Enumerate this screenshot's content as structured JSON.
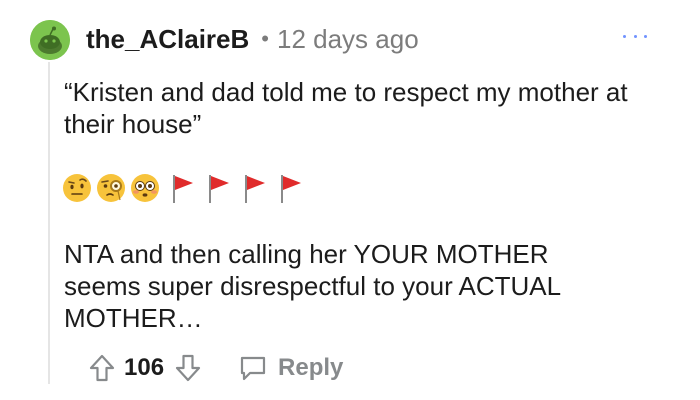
{
  "comment": {
    "author": "the_AClaireB",
    "separator": "•",
    "age": "12 days ago",
    "quote": "“Kristen and dad told me to respect my mother at their house”",
    "emojis": [
      "face-with-raised-eyebrow",
      "face-with-monocle",
      "flushed-face",
      "red-flag",
      "red-flag",
      "red-flag",
      "red-flag"
    ],
    "body": "NTA and then calling her YOUR MOTHER seems super disrespectful to your ACTUAL MOTHER…"
  },
  "actions": {
    "score": "106",
    "reply_label": "Reply"
  },
  "colors": {
    "avatar": "#7cc44e",
    "meta_text": "#7c7c7c",
    "more_dots": "#7193ff",
    "flag_red": "#e02b2b",
    "thread_line": "#e5e5e5"
  }
}
